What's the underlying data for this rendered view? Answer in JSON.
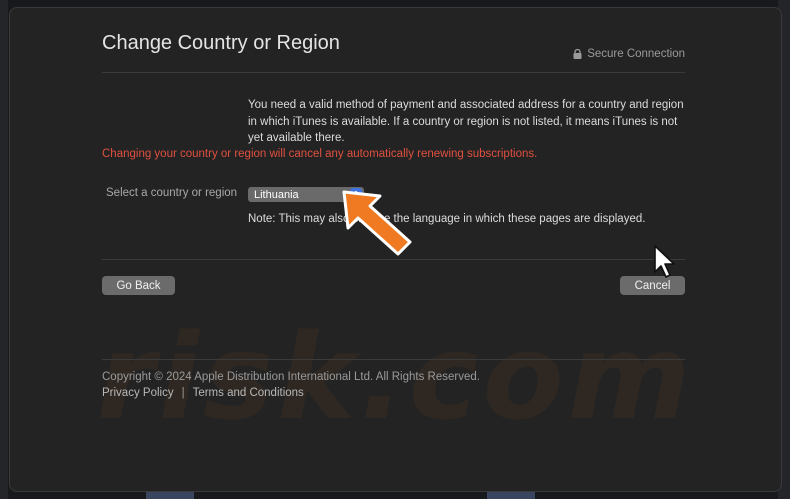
{
  "dialog": {
    "title": "Change Country or Region",
    "secure_label": "Secure Connection",
    "info_text": "You need a valid method of payment and associated address for a country and region in which iTunes is available. If a country or region is not listed, it means iTunes is not yet available there.",
    "warning_text": "Changing your country or region will cancel any automatically renewing subscriptions.",
    "select_label": "Select a country or region",
    "selected_country": "Lithuania",
    "note_text": "Note: This may also change the language in which these pages are displayed.",
    "back_button": "Go Back",
    "cancel_button": "Cancel"
  },
  "footer": {
    "copyright": "Copyright © 2024 Apple Distribution International Ltd. All Rights Reserved.",
    "privacy_link": "Privacy Policy",
    "separator": "|",
    "terms_link": "Terms and Conditions"
  },
  "watermark": "risk.com",
  "colors": {
    "warning": "#e05040",
    "highlight_arrow": "#f07a22",
    "select_accent": "#3d72e0"
  },
  "icons": [
    "lock-icon",
    "chevron-up-down-icon",
    "pointer-arrow-icon",
    "mouse-cursor-icon"
  ]
}
